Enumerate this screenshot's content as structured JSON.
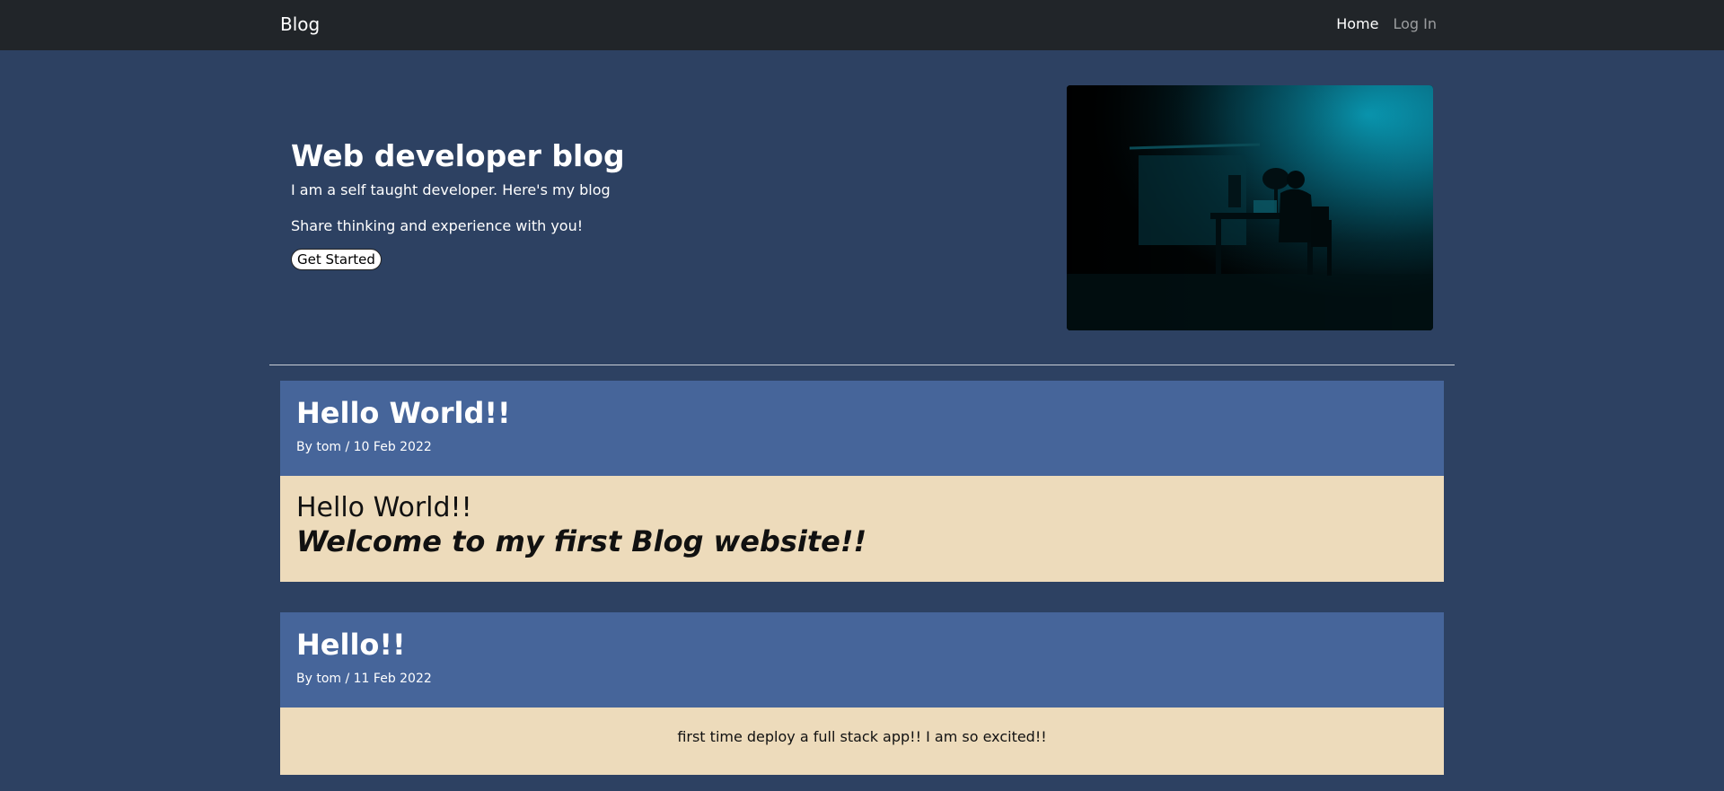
{
  "navbar": {
    "brand": "Blog",
    "links": [
      {
        "label": "Home",
        "active": true
      },
      {
        "label": "Log In",
        "active": false
      }
    ]
  },
  "hero": {
    "title": "Web developer blog",
    "lead": "I am a self taught developer. Here's my blog",
    "sub": "Share thinking and experience with you!",
    "button_label": "Get Started",
    "image_icon": "developer-at-desk-photo"
  },
  "posts": [
    {
      "title": "Hello World!!",
      "meta": "By tom / 10 Feb 2022",
      "body_line_1": "Hello World!!",
      "body_line_2": "Welcome to my first Blog website!!"
    },
    {
      "title": "Hello!!",
      "meta": "By tom / 11 Feb 2022",
      "body": "first time deploy a full stack app!! I am so excited!!"
    }
  ],
  "colors": {
    "page_background": "#2d4162",
    "navbar_background": "#212529",
    "post_header": "#46659a",
    "post_body": "#eddbbb"
  }
}
